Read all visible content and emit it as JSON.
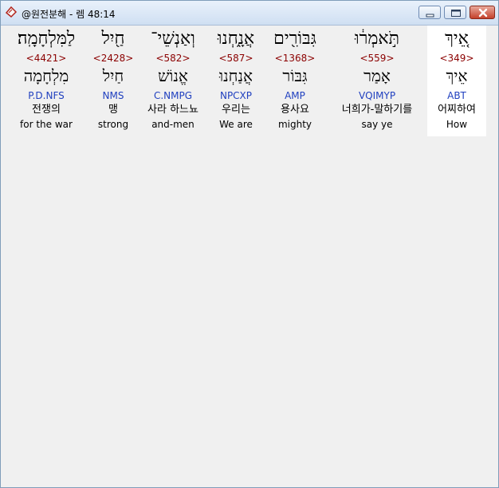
{
  "window": {
    "title": "@원전분해 - 렘 48:14",
    "controls": {
      "minimize": "minimize",
      "maximize": "maximize",
      "close": "close"
    }
  },
  "colors": {
    "strong": "#8b0000",
    "parse": "#1f3fbf",
    "selected_bg": "#ffffff",
    "pane_bg": "#f0f0f0"
  },
  "words": [
    {
      "heb": "אֵ֚יךְ",
      "strong": "<349>",
      "lemma": "אֵיךְ",
      "parse": "ABT",
      "kor": "어찌하여",
      "eng": "How",
      "selected": true
    },
    {
      "heb": "תֹּ֣אמְר֔וּ",
      "strong": "<559>",
      "lemma": "אָמַר",
      "parse": "VQIMYP",
      "kor": "너희가-말하기를",
      "eng": "say ye",
      "selected": false
    },
    {
      "heb": "גִּבּוֹרִ֖ים",
      "strong": "<1368>",
      "lemma": "גִּבּוֹר",
      "parse": "AMP",
      "kor": "용사요",
      "eng": "mighty",
      "selected": false
    },
    {
      "heb": "אֲנָ֑חְנוּ",
      "strong": "<587>",
      "lemma": "אֲנַחְנוּ",
      "parse": "NPCXP",
      "kor": "우리는",
      "eng": "We are",
      "selected": false
    },
    {
      "heb": "וְאַנְשֵׁי־",
      "strong": "<582>",
      "lemma": "אֱנוֹשׁ",
      "parse": "C.NMPG",
      "kor": "사라 하느뇨",
      "eng": "and-men",
      "selected": false
    },
    {
      "heb": "חַ֖יִל",
      "strong": "<2428>",
      "lemma": "חַיִל",
      "parse": "NMS",
      "kor": "맹",
      "eng": "strong",
      "selected": false
    },
    {
      "heb": "לַמִּלְחָמָֽה׃",
      "strong": "<4421>",
      "lemma": "מִלְחָמָה",
      "parse": "P.D.NFS",
      "kor": "전쟁의",
      "eng": "for the war",
      "selected": false
    }
  ]
}
